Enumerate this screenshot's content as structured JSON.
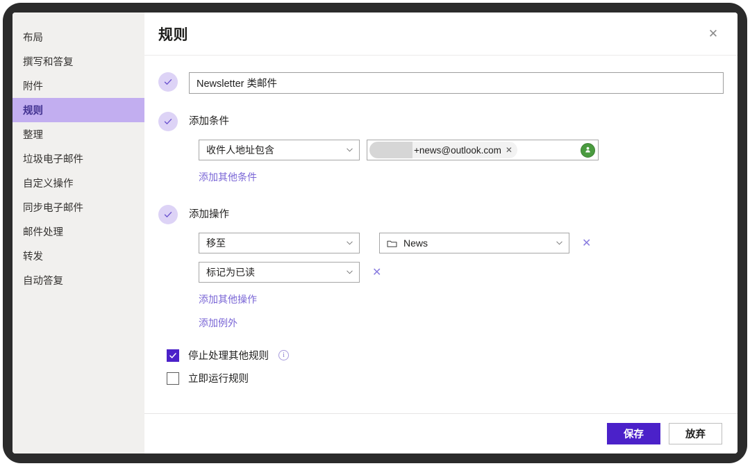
{
  "sidebar": {
    "items": [
      {
        "label": "布局",
        "active": false
      },
      {
        "label": "撰写和答复",
        "active": false
      },
      {
        "label": "附件",
        "active": false
      },
      {
        "label": "规则",
        "active": true
      },
      {
        "label": "整理",
        "active": false
      },
      {
        "label": "垃圾电子邮件",
        "active": false
      },
      {
        "label": "自定义操作",
        "active": false
      },
      {
        "label": "同步电子邮件",
        "active": false
      },
      {
        "label": "邮件处理",
        "active": false
      },
      {
        "label": "转发",
        "active": false
      },
      {
        "label": "自动答复",
        "active": false
      }
    ]
  },
  "header": {
    "title": "规则",
    "close_icon": "close-icon"
  },
  "rule": {
    "name_value": "Newsletter 类邮件",
    "name_placeholder": "",
    "condition_section_label": "添加条件",
    "condition_select_value": "收件人地址包含",
    "recipient_pill_text": "+news@outlook.com",
    "recipient_pill_remove": "✕",
    "recipient_avatar_icon": "contact-avatar-icon",
    "add_condition_link": "添加其他条件",
    "action_section_label": "添加操作",
    "actions": [
      {
        "select_value": "移至",
        "has_folder": true,
        "folder_icon": "folder-icon",
        "folder_value": "News",
        "remove": "✕"
      },
      {
        "select_value": "标记为已读",
        "has_folder": false,
        "folder_icon": "",
        "folder_value": "",
        "remove": "✕"
      }
    ],
    "add_action_link": "添加其他操作",
    "add_exception_link": "添加例外",
    "stop_processing_label": "停止处理其他规则",
    "stop_processing_checked": true,
    "stop_processing_info_icon": "info-icon",
    "run_now_label": "立即运行规则",
    "run_now_checked": false
  },
  "footer": {
    "save_label": "保存",
    "discard_label": "放弃"
  },
  "colors": {
    "accent_purple": "#4b21c9",
    "sidebar_active": "#c2aef0",
    "link_purple": "#7a66d6",
    "avatar_green": "#4a9b3f",
    "frame_dark": "#2b2b2b"
  }
}
